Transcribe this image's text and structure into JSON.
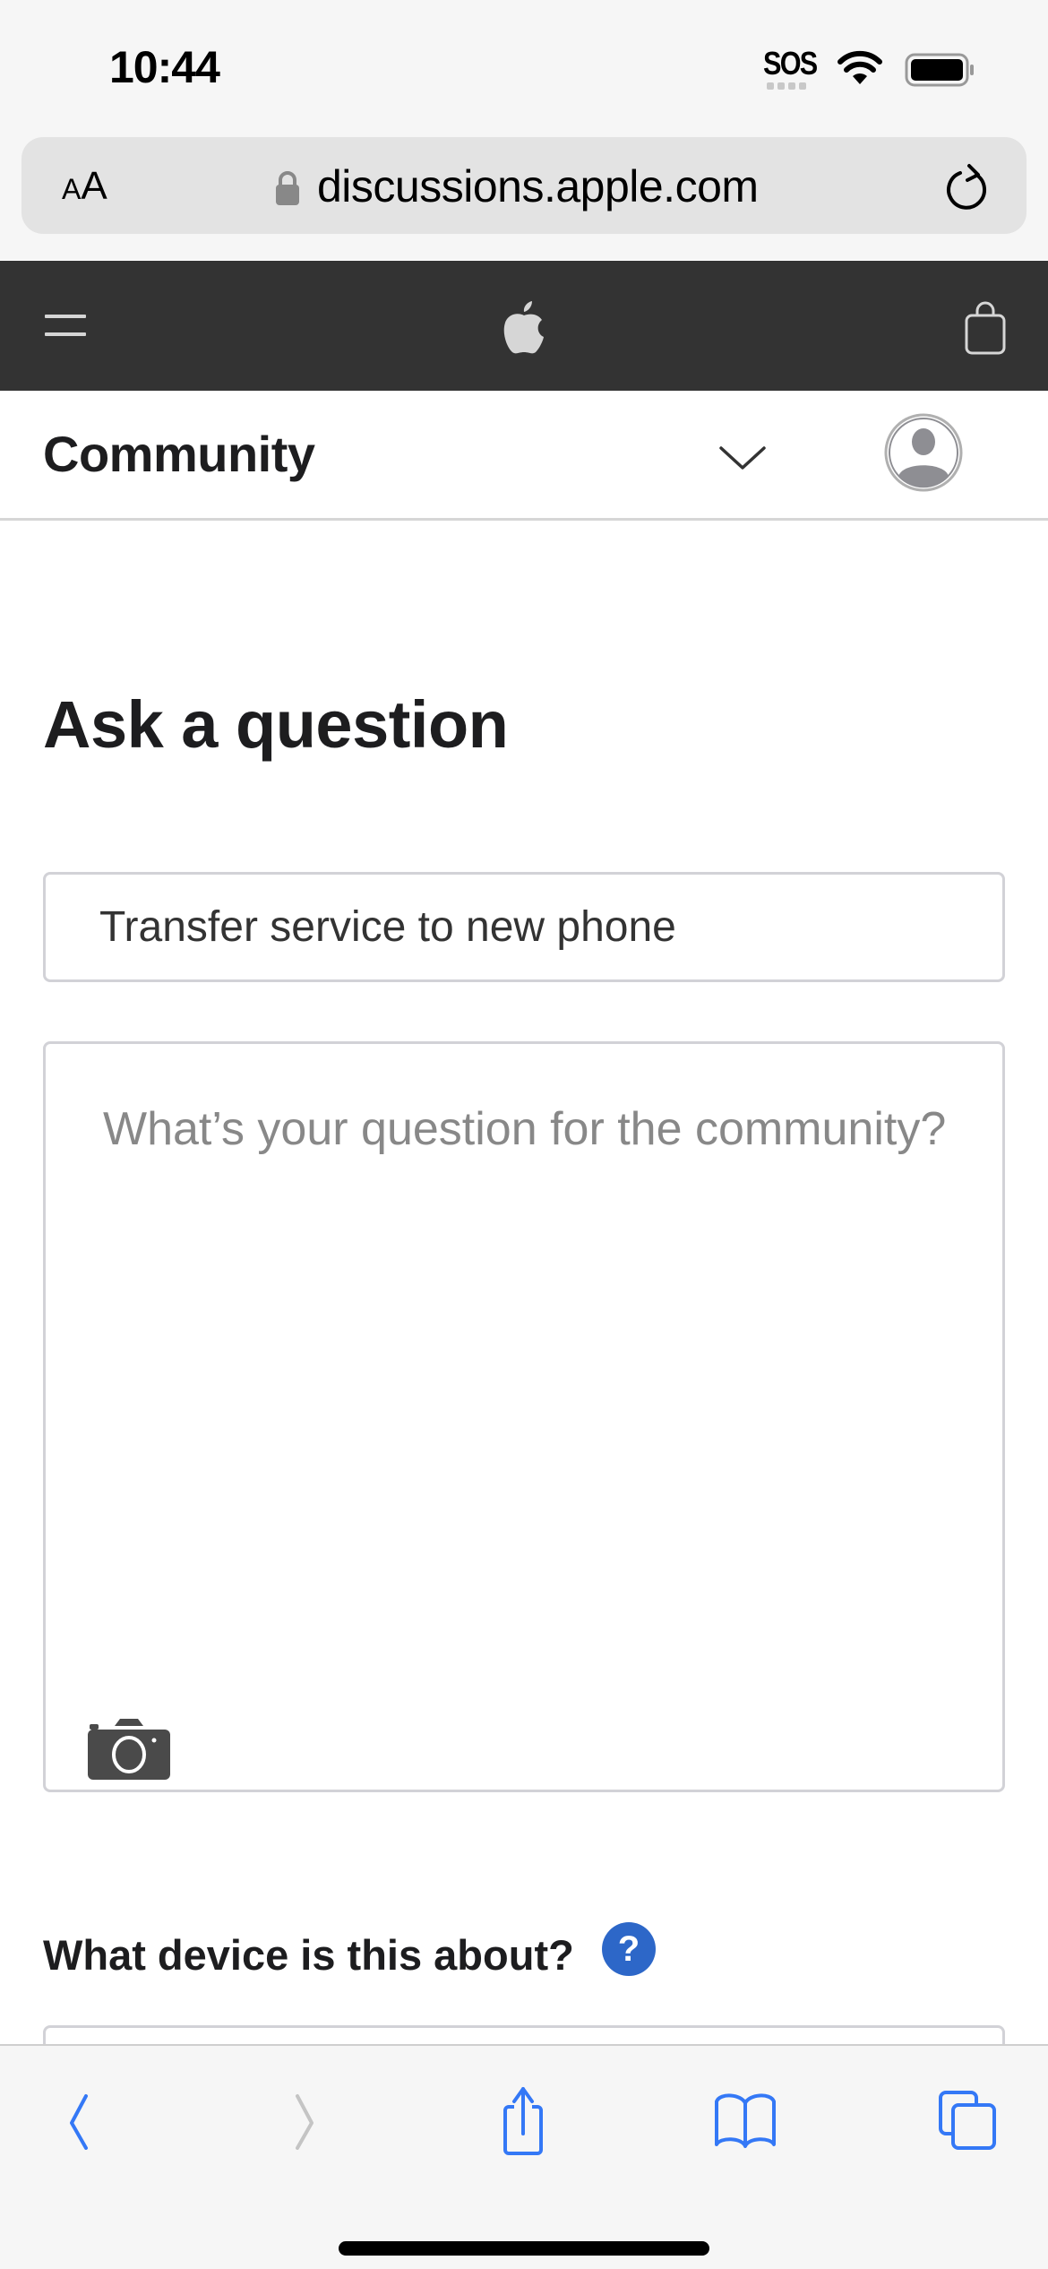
{
  "status_bar": {
    "time": "10:44",
    "carrier_status": "SOS",
    "icons": [
      "wifi-icon",
      "battery-icon"
    ]
  },
  "browser": {
    "text_size_label_small": "A",
    "text_size_label_large": "A",
    "url": "discussions.apple.com",
    "icons": [
      "lock-icon",
      "reload-icon"
    ]
  },
  "apple_nav": {
    "icons": [
      "hamburger-menu-icon",
      "apple-logo-icon",
      "shopping-bag-icon"
    ]
  },
  "community_bar": {
    "title": "Community",
    "icons": [
      "chevron-down-icon",
      "avatar-icon"
    ]
  },
  "main": {
    "page_title": "Ask a question",
    "subject_input": {
      "value": "Transfer service to new phone",
      "placeholder": ""
    },
    "question_textarea": {
      "value": "",
      "placeholder": "What’s your question for the community?"
    },
    "device_label": "What device is this about?",
    "help_icon_label": "?"
  },
  "toolbar": {
    "items": [
      {
        "name": "back",
        "icon": "chevron-left-icon",
        "enabled": true
      },
      {
        "name": "forward",
        "icon": "chevron-right-icon",
        "enabled": false
      },
      {
        "name": "share",
        "icon": "share-icon",
        "enabled": true
      },
      {
        "name": "bookmarks",
        "icon": "book-icon",
        "enabled": true
      },
      {
        "name": "tabs",
        "icon": "tabs-icon",
        "enabled": true
      }
    ]
  },
  "colors": {
    "accent": "#3478f6",
    "nav_background": "#333333",
    "help_badge": "#2d67c8",
    "disabled": "#c4c4c4",
    "placeholder": "#888888"
  }
}
